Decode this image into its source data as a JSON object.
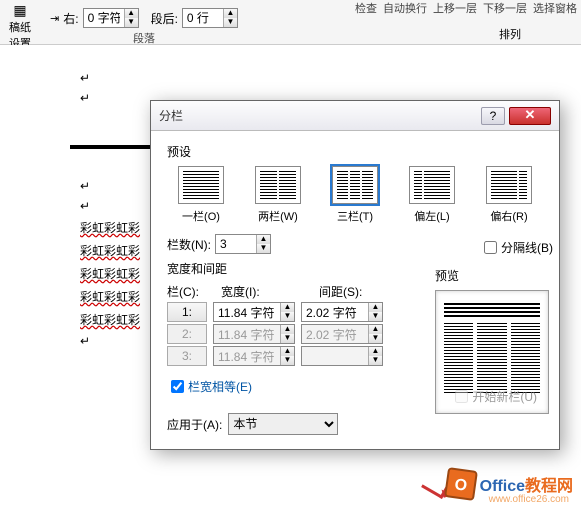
{
  "ribbon": {
    "gaozhi": "稿纸\n设置",
    "gaozhi2": "稿纸",
    "indent_right_lbl": "右:",
    "indent_right_val": "0 字符",
    "spacing_after_lbl": "段后:",
    "spacing_after_val": "0 行",
    "group_para": "段落",
    "group_arrange": "排列",
    "menu": [
      "检查",
      "自动换行",
      "上移一层",
      "下移一层",
      "选择窗格"
    ]
  },
  "doc": {
    "rainbow": "彩虹彩虹彩"
  },
  "dialog": {
    "title": "分栏",
    "presets_label": "预设",
    "presets": {
      "one": "一栏(O)",
      "two": "两栏(W)",
      "three": "三栏(T)",
      "left": "偏左(L)",
      "right": "偏右(R)"
    },
    "selected_preset": "three",
    "cols_label": "栏数(N):",
    "cols_value": "3",
    "divider_label": "分隔线(B)",
    "divider_checked": false,
    "width_spacing_label": "宽度和间距",
    "preview_label": "预览",
    "col_head": "栏(C):",
    "width_head": "宽度(I):",
    "spacing_head": "间距(S):",
    "rows": [
      {
        "idx": "1:",
        "width": "11.84 字符",
        "spacing": "2.02 字符",
        "enabled": true
      },
      {
        "idx": "2:",
        "width": "11.84 字符",
        "spacing": "2.02 字符",
        "enabled": false
      },
      {
        "idx": "3:",
        "width": "11.84 字符",
        "spacing": "",
        "enabled": false
      }
    ],
    "equal_label": "栏宽相等(E)",
    "equal_checked": true,
    "apply_label": "应用于(A):",
    "apply_value": "本节",
    "start_new_label": "开始新栏(U)"
  },
  "watermark": {
    "brand1": "Office",
    "brand2": "教程网",
    "url": "www.office26.com"
  }
}
